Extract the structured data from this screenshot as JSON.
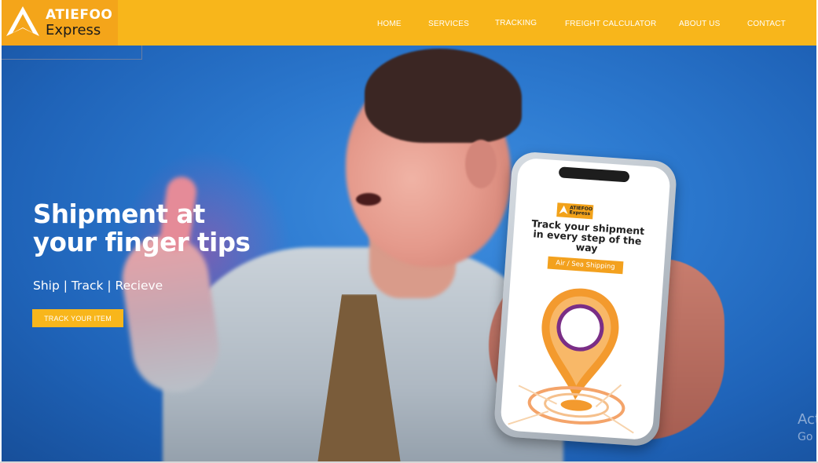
{
  "brand": {
    "name_line1": "ATIEFOO",
    "name_line2": "Express",
    "primary_color": "#f8b61b",
    "logo_bg_color": "#f4a51a"
  },
  "nav": {
    "items": [
      {
        "label": "HOME"
      },
      {
        "label": "SERVICES"
      },
      {
        "label": "TRACKING"
      },
      {
        "label": "FREIGHT CALCULATOR"
      },
      {
        "label": "ABOUT US"
      },
      {
        "label": "CONTACT"
      }
    ]
  },
  "hero": {
    "title_line1": "Shipment at",
    "title_line2": "your finger tips",
    "subtitle": "Ship | Track | Recieve",
    "button_label": "TRACK YOUR ITEM",
    "background_color": "#2c79cf"
  },
  "phone_screen": {
    "logo_text": "ATIEFOO Express",
    "headline": "Track your shipment in every step of the way",
    "badge": "Air / Sea Shipping",
    "icon": "location-pin-icon"
  },
  "overlay": {
    "line1": "Act",
    "line2": "Go t"
  }
}
